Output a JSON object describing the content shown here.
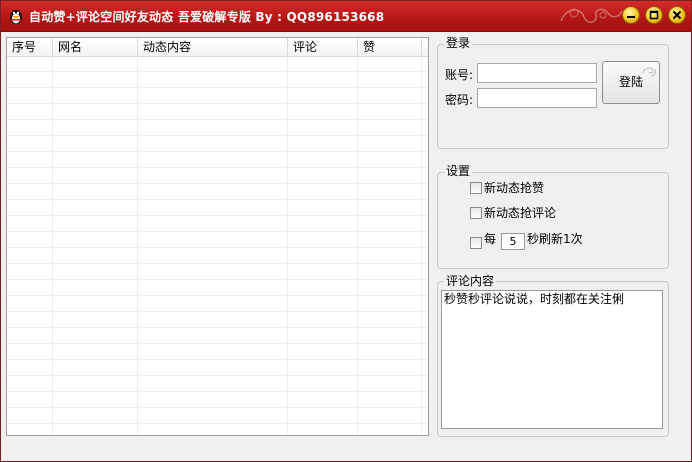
{
  "window": {
    "title": "自动赞+评论空间好友动态 吾爱破解专版  By : QQ896153668"
  },
  "list": {
    "columns": [
      "序号",
      "网名",
      "动态内容",
      "评论",
      "赞"
    ]
  },
  "login": {
    "legend": "登录",
    "account_label": "账号:",
    "password_label": "密码:",
    "account_value": "",
    "password_value": "",
    "login_button": "登陆"
  },
  "settings": {
    "legend": "设置",
    "option_like": "新动态抢赞",
    "option_comment": "新动态抢评论",
    "refresh_prefix": "每",
    "refresh_seconds": "5",
    "refresh_suffix": "秒刷新1次"
  },
  "comment": {
    "legend": "评论内容",
    "text": "秒赞秒评论说说，时刻都在关注俐"
  },
  "colors": {
    "titlebar": "#b31616",
    "window_bg": "#f0f0f0",
    "control_button": "#f3c419"
  }
}
